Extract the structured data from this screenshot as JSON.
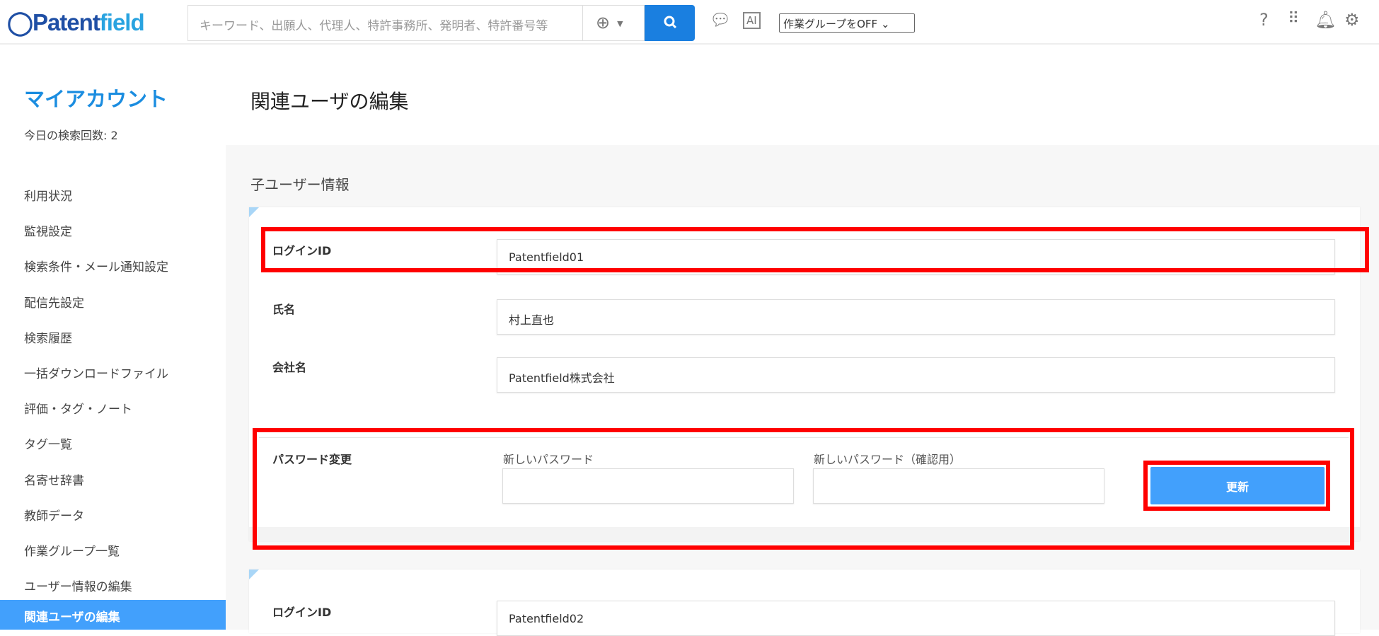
{
  "header": {
    "logo": "Patentfield",
    "search_placeholder": "キーワード、出願人、代理人、特許事務所、発明者、特許番号等",
    "ai_label": "AI",
    "work_group_select": "作業グループをOFF"
  },
  "sidebar": {
    "title": "マイアカウント",
    "search_count": "今日の検索回数: 2",
    "items": [
      {
        "label": "利用状況"
      },
      {
        "label": "監視設定"
      },
      {
        "label": "検索条件・メール通知設定"
      },
      {
        "label": "配信先設定"
      },
      {
        "label": "検索履歴"
      },
      {
        "label": "一括ダウンロードファイル"
      },
      {
        "label": "評価・タグ・ノート"
      },
      {
        "label": "タグ一覧"
      },
      {
        "label": "名寄せ辞書"
      },
      {
        "label": "教師データ"
      },
      {
        "label": "作業グループ一覧"
      },
      {
        "label": "ユーザー情報の編集"
      },
      {
        "label": "関連ユーザの編集",
        "active": true
      }
    ]
  },
  "main": {
    "page_title": "関連ユーザの編集",
    "section_title": "子ユーザー情報",
    "user1": {
      "login_id_label": "ログインID",
      "login_id": "Patentfield01",
      "name_label": "氏名",
      "name": "村上直也",
      "company_label": "会社名",
      "company": "Patentfield株式会社",
      "password_label": "パスワード変更",
      "new_password_label": "新しいパスワード",
      "confirm_password_label": "新しいパスワード（確認用）",
      "update_button": "更新"
    },
    "user2": {
      "login_id_label": "ログインID",
      "login_id": "Patentfield02"
    }
  }
}
